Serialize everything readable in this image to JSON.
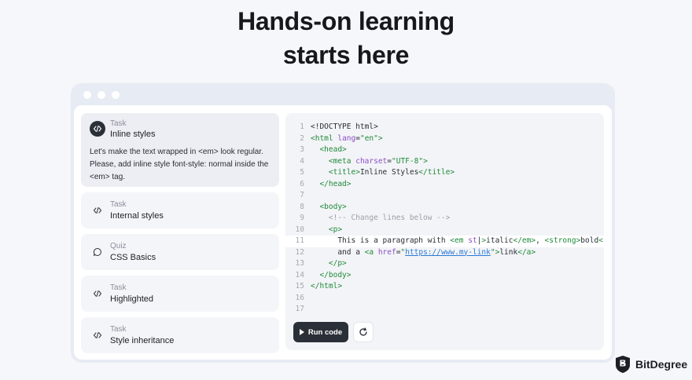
{
  "hero": {
    "line1": "Hands-on learning",
    "line2": "starts here"
  },
  "tasks": [
    {
      "kind": "Task",
      "name": "Inline styles",
      "icon": "code-icon",
      "active": true,
      "desc": "Let's make the text wrapped in <em> look regular. Please, add inline style font-style: normal inside the <em> tag."
    },
    {
      "kind": "Task",
      "name": "Internal styles",
      "icon": "code-icon"
    },
    {
      "kind": "Quiz",
      "name": "CSS Basics",
      "icon": "chat-bubble-icon"
    },
    {
      "kind": "Task",
      "name": "Highlighted",
      "icon": "code-icon"
    },
    {
      "kind": "Task",
      "name": "Style inheritance",
      "icon": "code-icon"
    }
  ],
  "editor": {
    "line_numbers": [
      "1",
      "2",
      "3",
      "4",
      "5",
      "6",
      "7",
      "8",
      "9",
      "10",
      "11",
      "12",
      "13",
      "14",
      "15",
      "16",
      "17"
    ],
    "highlighted_line": 11
  },
  "buttons": {
    "run_label": "Run code",
    "reset_icon": "refresh-icon"
  },
  "brand": {
    "name": "BitDegree",
    "icon": "bitdegree-shield-logo"
  },
  "colors": {
    "accent_dark": "#2b2f38",
    "tag_green": "#1f8a3a",
    "attr_purple": "#8b4fc7",
    "link_blue": "#2a7ad6"
  }
}
